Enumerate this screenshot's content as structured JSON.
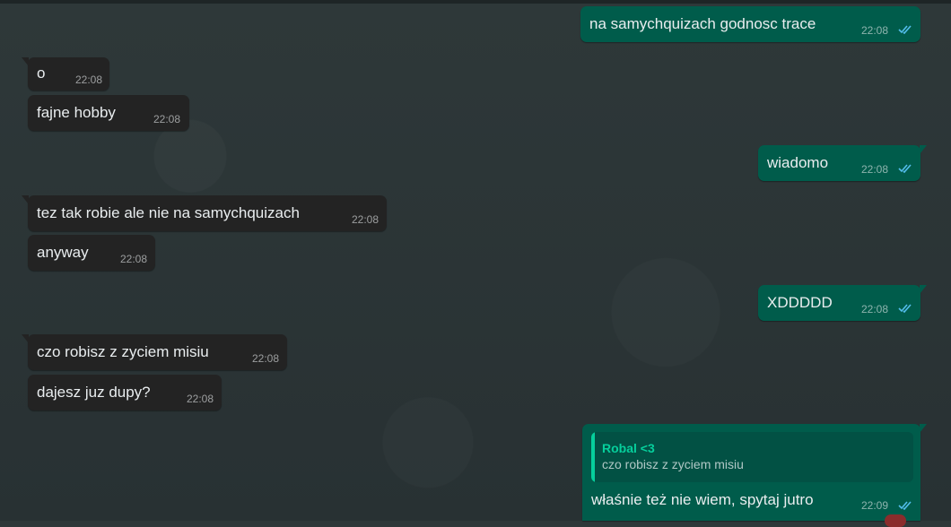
{
  "chat": {
    "messages": [
      {
        "id": "m1",
        "direction": "outgoing",
        "text": "na samychquizach godnosc trace",
        "time": "22:08",
        "status": "read"
      },
      {
        "id": "m2",
        "direction": "incoming",
        "text": "o",
        "time": "22:08"
      },
      {
        "id": "m3",
        "direction": "incoming",
        "text": "fajne hobby",
        "time": "22:08"
      },
      {
        "id": "m4",
        "direction": "outgoing",
        "text": "wiadomo",
        "time": "22:08",
        "status": "read"
      },
      {
        "id": "m5",
        "direction": "incoming",
        "text": "tez tak robie ale nie na samychquizach",
        "time": "22:08"
      },
      {
        "id": "m6",
        "direction": "incoming",
        "text": "anyway",
        "time": "22:08"
      },
      {
        "id": "m7",
        "direction": "outgoing",
        "text": "XDDDDD",
        "time": "22:08",
        "status": "read"
      },
      {
        "id": "m8",
        "direction": "incoming",
        "text": "czo robisz z zyciem misiu",
        "time": "22:08"
      },
      {
        "id": "m9",
        "direction": "incoming",
        "text": "dajesz juz dupy?",
        "time": "22:08"
      },
      {
        "id": "m10",
        "direction": "outgoing",
        "text": "właśnie też nie wiem, spytaj jutro",
        "time": "22:09",
        "status": "read",
        "reply": {
          "author": "Robal <3",
          "text": "czo robisz z zyciem misiu"
        }
      }
    ]
  },
  "colors": {
    "incoming_bubble": "#232323",
    "outgoing_bubble": "#005c4b",
    "read_ticks": "#53bdeb",
    "quote_author": "#06cf9c",
    "wallpaper": "#2b3436"
  },
  "icons": {
    "read_receipt": "double-check-icon"
  }
}
